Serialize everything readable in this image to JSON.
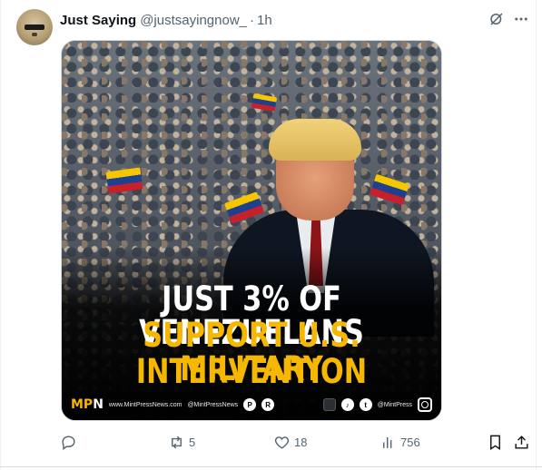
{
  "tweet": {
    "author_name": "Just Saying",
    "handle": "@justsayingnow_",
    "separator": "·",
    "time": "1h"
  },
  "media": {
    "headline_line1": "JUST 3% OF VENEZUELANS",
    "headline_line2": "SUPPORT U.S. MILITARY",
    "headline_line3": "INTERVENTION",
    "logo_left": "MP",
    "logo_right": "N",
    "website": "www.MintPressNews.com",
    "handle1": "@MintPressNews",
    "handle2": "@MintPress",
    "colors": {
      "accent": "#f5b700",
      "white_text": "#ffffff"
    }
  },
  "actions": {
    "reply_count": "",
    "retweet_count": "5",
    "like_count": "18",
    "views_count": "756"
  },
  "icons": [
    "grok-icon",
    "more-icon",
    "reply-icon",
    "retweet-icon",
    "like-icon",
    "views-icon",
    "bookmark-icon",
    "share-icon"
  ],
  "colors": {
    "muted_text": "#536471",
    "primary_text": "#0f1419"
  }
}
